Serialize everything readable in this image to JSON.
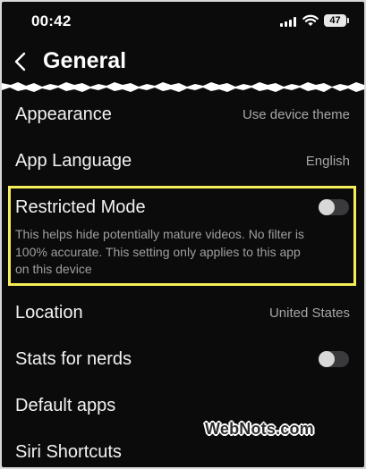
{
  "status_bar": {
    "time": "00:42",
    "battery": "47"
  },
  "header": {
    "title": "General"
  },
  "rows": {
    "appearance": {
      "label": "Appearance",
      "value": "Use device theme"
    },
    "app_language": {
      "label": "App Language",
      "value": "English"
    },
    "restricted_mode": {
      "label": "Restricted Mode",
      "enabled": false,
      "description": "This helps hide potentially mature videos. No filter is 100% accurate. This setting only applies to this app on this device"
    },
    "location": {
      "label": "Location",
      "value": "United States"
    },
    "stats_for_nerds": {
      "label": "Stats for nerds",
      "enabled": false
    },
    "default_apps": {
      "label": "Default apps"
    },
    "siri_shortcuts": {
      "label": "Siri Shortcuts"
    }
  },
  "watermark": "WebNots.com",
  "colors": {
    "highlight": "#f5ee58",
    "background": "#0b0b0b",
    "toggle_off_track": "#3a3a3c"
  }
}
